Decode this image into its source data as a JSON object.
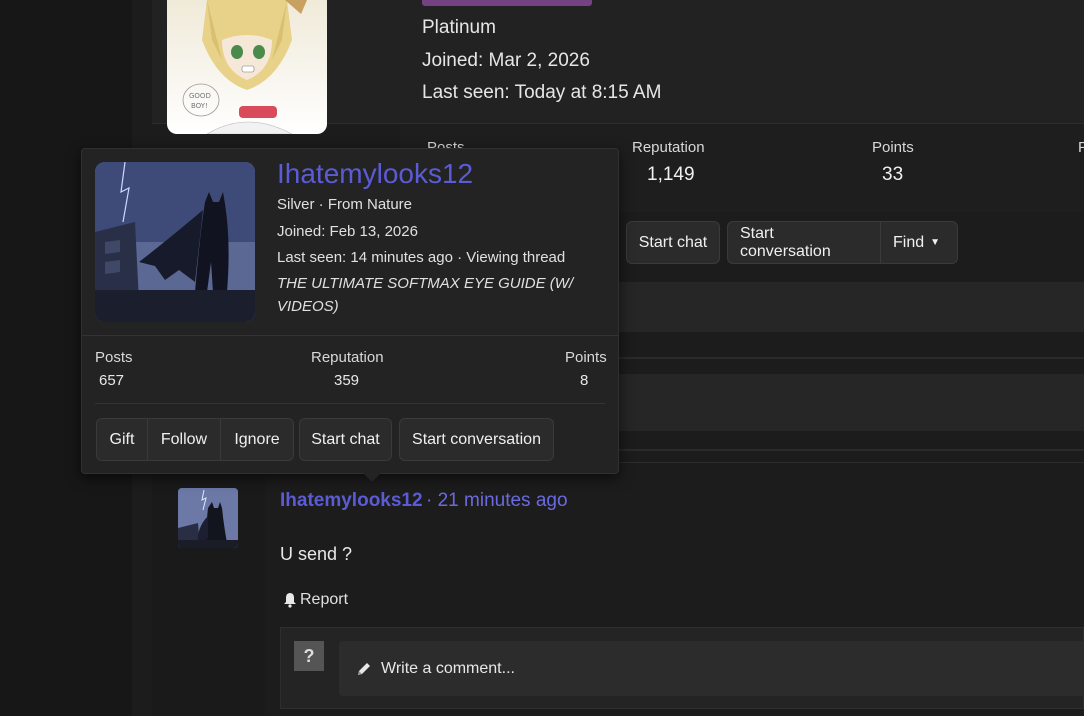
{
  "background_member": {
    "rank": "Platinum",
    "joined": "Joined: Mar 2, 2026",
    "last_seen": "Last seen: Today at 8:15 AM",
    "stats": [
      {
        "label": "Posts",
        "value": ""
      },
      {
        "label": "Reputation",
        "value": "1,149"
      },
      {
        "label": "Points",
        "value": "33"
      }
    ],
    "buttons": {
      "start_chat": "Start chat",
      "start_conversation": "Start conversation",
      "find": "Find"
    }
  },
  "popup": {
    "username": "Ihatemylooks12",
    "rank_line": "Silver · From Nature",
    "joined": "Joined: Feb 13, 2026",
    "last_seen": "Last seen: 14 minutes ago · Viewing thread",
    "thread_title": "THE ULTIMATE SOFTMAX EYE GUIDE (W/ VIDEOS)",
    "stats": [
      {
        "label": "Posts",
        "value": "657"
      },
      {
        "label": "Reputation",
        "value": "359"
      },
      {
        "label": "Points",
        "value": "8"
      }
    ],
    "buttons": {
      "gift": "Gift",
      "follow": "Follow",
      "ignore": "Ignore",
      "start_chat": "Start chat",
      "start_conversation": "Start conversation"
    }
  },
  "comment": {
    "username": "Ihatemylooks12",
    "time": "· 21 minutes ago",
    "text": "U send ?",
    "report_label": "Report",
    "reply_avatar": "?",
    "reply_placeholder": "Write a comment..."
  },
  "colors": {
    "username_link": "#5b5bd6",
    "background": "#141414",
    "panel": "#232323"
  }
}
